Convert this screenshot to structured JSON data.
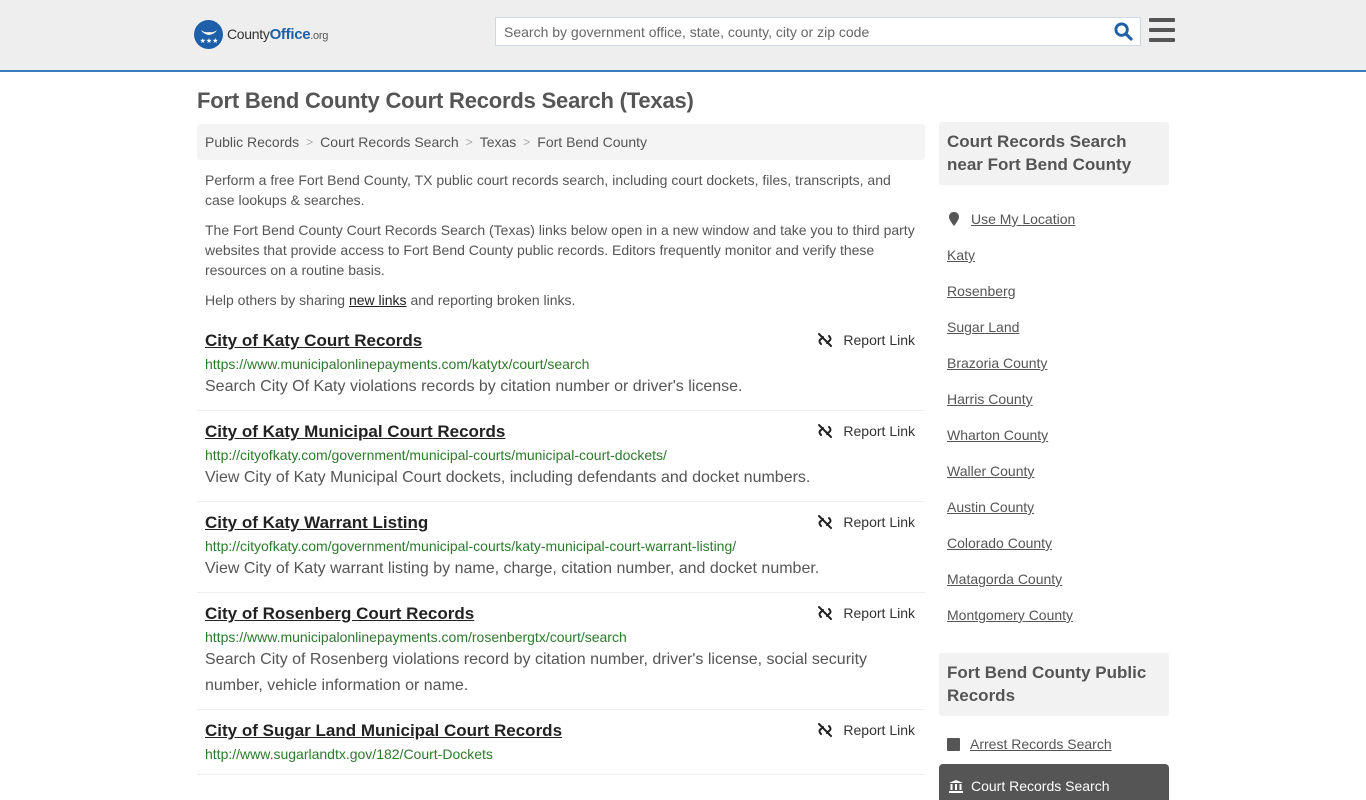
{
  "header": {
    "logo": {
      "part1": "County",
      "part2": "Office",
      "part3": ".org"
    },
    "search_placeholder": "Search by government office, state, county, city or zip code",
    "search_icon": "search-icon",
    "menu_icon": "hamburger-menu-icon",
    "accent_color": "#3b7bbf"
  },
  "page": {
    "title": "Fort Bend County Court Records Search (Texas)",
    "breadcrumb": [
      "Public Records",
      "Court Records Search",
      "Texas",
      "Fort Bend County"
    ],
    "intro": {
      "p1": "Perform a free Fort Bend County, TX public court records search, including court dockets, files, transcripts, and case lookups & searches.",
      "p2": "The Fort Bend County Court Records Search (Texas) links below open in a new window and take you to third party websites that provide access to Fort Bend County public records. Editors frequently monitor and verify these resources on a routine basis.",
      "p3_before": "Help others by sharing ",
      "p3_link": "new links",
      "p3_after": " and reporting broken links."
    }
  },
  "results": [
    {
      "title": "City of Katy Court Records",
      "url": "https://www.municipalonlinepayments.com/katytx/court/search",
      "description": "Search City Of Katy violations records by citation number or driver's license.",
      "report_label": "Report Link"
    },
    {
      "title": "City of Katy Municipal Court Records",
      "url": "http://cityofkaty.com/government/municipal-courts/municipal-court-dockets/",
      "description": "View City of Katy Municipal Court dockets, including defendants and docket numbers.",
      "report_label": "Report Link"
    },
    {
      "title": "City of Katy Warrant Listing",
      "url": "http://cityofkaty.com/government/municipal-courts/katy-municipal-court-warrant-listing/",
      "description": "View City of Katy warrant listing by name, charge, citation number, and docket number.",
      "report_label": "Report Link"
    },
    {
      "title": "City of Rosenberg Court Records",
      "url": "https://www.municipalonlinepayments.com/rosenbergtx/court/search",
      "description": "Search City of Rosenberg violations record by citation number, driver's license, social security number, vehicle information or name.",
      "report_label": "Report Link"
    },
    {
      "title": "City of Sugar Land Municipal Court Records",
      "url": "http://www.sugarlandtx.gov/182/Court-Dockets",
      "description": "",
      "report_label": "Report Link"
    }
  ],
  "sidebar": {
    "nearby_heading": "Court Records Search near Fort Bend County",
    "use_location": "Use My Location",
    "nearby": [
      "Katy",
      "Rosenberg",
      "Sugar Land",
      "Brazoria County",
      "Harris County",
      "Wharton County",
      "Waller County",
      "Austin County",
      "Colorado County",
      "Matagorda County",
      "Montgomery County"
    ],
    "public_records_heading": "Fort Bend County Public Records",
    "public_records": [
      {
        "label": "Arrest Records Search",
        "icon": "square-icon",
        "active": false
      },
      {
        "label": "Court Records Search",
        "icon": "courthouse-icon",
        "active": true
      }
    ]
  }
}
